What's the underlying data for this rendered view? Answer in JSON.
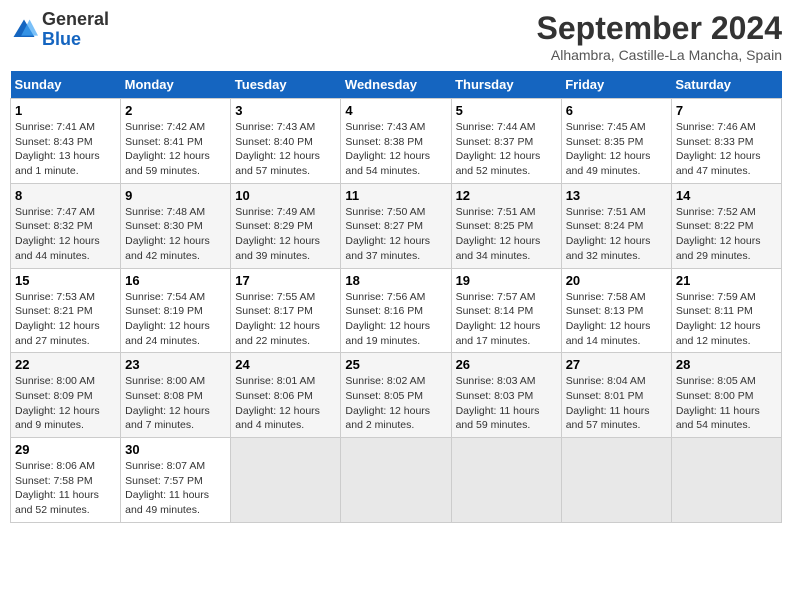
{
  "header": {
    "logo": {
      "line1": "General",
      "line2": "Blue"
    },
    "title": "September 2024",
    "subtitle": "Alhambra, Castille-La Mancha, Spain"
  },
  "days_of_week": [
    "Sunday",
    "Monday",
    "Tuesday",
    "Wednesday",
    "Thursday",
    "Friday",
    "Saturday"
  ],
  "weeks": [
    [
      {
        "day": "1",
        "sunrise": "7:41 AM",
        "sunset": "8:43 PM",
        "daylight": "13 hours and 1 minute."
      },
      {
        "day": "2",
        "sunrise": "7:42 AM",
        "sunset": "8:41 PM",
        "daylight": "12 hours and 59 minutes."
      },
      {
        "day": "3",
        "sunrise": "7:43 AM",
        "sunset": "8:40 PM",
        "daylight": "12 hours and 57 minutes."
      },
      {
        "day": "4",
        "sunrise": "7:43 AM",
        "sunset": "8:38 PM",
        "daylight": "12 hours and 54 minutes."
      },
      {
        "day": "5",
        "sunrise": "7:44 AM",
        "sunset": "8:37 PM",
        "daylight": "12 hours and 52 minutes."
      },
      {
        "day": "6",
        "sunrise": "7:45 AM",
        "sunset": "8:35 PM",
        "daylight": "12 hours and 49 minutes."
      },
      {
        "day": "7",
        "sunrise": "7:46 AM",
        "sunset": "8:33 PM",
        "daylight": "12 hours and 47 minutes."
      }
    ],
    [
      {
        "day": "8",
        "sunrise": "7:47 AM",
        "sunset": "8:32 PM",
        "daylight": "12 hours and 44 minutes."
      },
      {
        "day": "9",
        "sunrise": "7:48 AM",
        "sunset": "8:30 PM",
        "daylight": "12 hours and 42 minutes."
      },
      {
        "day": "10",
        "sunrise": "7:49 AM",
        "sunset": "8:29 PM",
        "daylight": "12 hours and 39 minutes."
      },
      {
        "day": "11",
        "sunrise": "7:50 AM",
        "sunset": "8:27 PM",
        "daylight": "12 hours and 37 minutes."
      },
      {
        "day": "12",
        "sunrise": "7:51 AM",
        "sunset": "8:25 PM",
        "daylight": "12 hours and 34 minutes."
      },
      {
        "day": "13",
        "sunrise": "7:51 AM",
        "sunset": "8:24 PM",
        "daylight": "12 hours and 32 minutes."
      },
      {
        "day": "14",
        "sunrise": "7:52 AM",
        "sunset": "8:22 PM",
        "daylight": "12 hours and 29 minutes."
      }
    ],
    [
      {
        "day": "15",
        "sunrise": "7:53 AM",
        "sunset": "8:21 PM",
        "daylight": "12 hours and 27 minutes."
      },
      {
        "day": "16",
        "sunrise": "7:54 AM",
        "sunset": "8:19 PM",
        "daylight": "12 hours and 24 minutes."
      },
      {
        "day": "17",
        "sunrise": "7:55 AM",
        "sunset": "8:17 PM",
        "daylight": "12 hours and 22 minutes."
      },
      {
        "day": "18",
        "sunrise": "7:56 AM",
        "sunset": "8:16 PM",
        "daylight": "12 hours and 19 minutes."
      },
      {
        "day": "19",
        "sunrise": "7:57 AM",
        "sunset": "8:14 PM",
        "daylight": "12 hours and 17 minutes."
      },
      {
        "day": "20",
        "sunrise": "7:58 AM",
        "sunset": "8:13 PM",
        "daylight": "12 hours and 14 minutes."
      },
      {
        "day": "21",
        "sunrise": "7:59 AM",
        "sunset": "8:11 PM",
        "daylight": "12 hours and 12 minutes."
      }
    ],
    [
      {
        "day": "22",
        "sunrise": "8:00 AM",
        "sunset": "8:09 PM",
        "daylight": "12 hours and 9 minutes."
      },
      {
        "day": "23",
        "sunrise": "8:00 AM",
        "sunset": "8:08 PM",
        "daylight": "12 hours and 7 minutes."
      },
      {
        "day": "24",
        "sunrise": "8:01 AM",
        "sunset": "8:06 PM",
        "daylight": "12 hours and 4 minutes."
      },
      {
        "day": "25",
        "sunrise": "8:02 AM",
        "sunset": "8:05 PM",
        "daylight": "12 hours and 2 minutes."
      },
      {
        "day": "26",
        "sunrise": "8:03 AM",
        "sunset": "8:03 PM",
        "daylight": "11 hours and 59 minutes."
      },
      {
        "day": "27",
        "sunrise": "8:04 AM",
        "sunset": "8:01 PM",
        "daylight": "11 hours and 57 minutes."
      },
      {
        "day": "28",
        "sunrise": "8:05 AM",
        "sunset": "8:00 PM",
        "daylight": "11 hours and 54 minutes."
      }
    ],
    [
      {
        "day": "29",
        "sunrise": "8:06 AM",
        "sunset": "7:58 PM",
        "daylight": "11 hours and 52 minutes."
      },
      {
        "day": "30",
        "sunrise": "8:07 AM",
        "sunset": "7:57 PM",
        "daylight": "11 hours and 49 minutes."
      },
      null,
      null,
      null,
      null,
      null
    ]
  ]
}
